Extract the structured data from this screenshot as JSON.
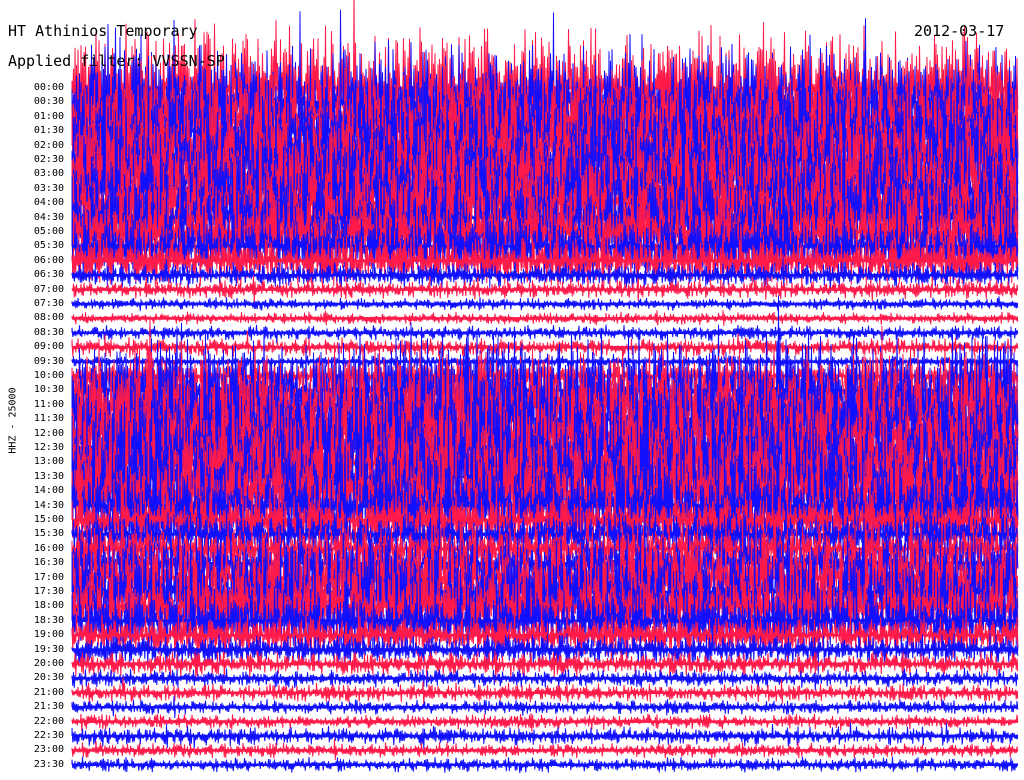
{
  "header": {
    "station": "HT Athinios Temporary",
    "date": "2012-03-17",
    "filter": "Applied filter: VVSSN-SP"
  },
  "axis_label": "HHZ - 25000",
  "chart_data": {
    "type": "helicorder",
    "title": "HT Athinios Temporary",
    "date": "2012-03-17",
    "channel_label": "HHZ - 25000",
    "row_interval_minutes": 30,
    "colors": {
      "odd": "#ff1a4a",
      "even": "#1010ff"
    },
    "rows": [
      {
        "time": "00:00",
        "amplitude": 1.0
      },
      {
        "time": "00:30",
        "amplitude": 1.0
      },
      {
        "time": "01:00",
        "amplitude": 1.0
      },
      {
        "time": "01:30",
        "amplitude": 1.0
      },
      {
        "time": "02:00",
        "amplitude": 1.0
      },
      {
        "time": "02:30",
        "amplitude": 1.0
      },
      {
        "time": "03:00",
        "amplitude": 1.0
      },
      {
        "time": "03:30",
        "amplitude": 1.0
      },
      {
        "time": "04:00",
        "amplitude": 1.0
      },
      {
        "time": "04:30",
        "amplitude": 0.9
      },
      {
        "time": "05:00",
        "amplitude": 0.8
      },
      {
        "time": "05:30",
        "amplitude": 0.6
      },
      {
        "time": "06:00",
        "amplitude": 0.45
      },
      {
        "time": "06:30",
        "amplitude": 0.2
      },
      {
        "time": "07:00",
        "amplitude": 0.15
      },
      {
        "time": "07:30",
        "amplitude": 0.1
      },
      {
        "time": "08:00",
        "amplitude": 0.1
      },
      {
        "time": "08:30",
        "amplitude": 0.12
      },
      {
        "time": "09:00",
        "amplitude": 0.15
      },
      {
        "time": "09:30",
        "amplitude": 0.1
      },
      {
        "time": "10:00",
        "amplitude": 0.3
      },
      {
        "time": "10:30",
        "amplitude": 1.0
      },
      {
        "time": "11:00",
        "amplitude": 1.0
      },
      {
        "time": "11:30",
        "amplitude": 1.0
      },
      {
        "time": "12:00",
        "amplitude": 1.0
      },
      {
        "time": "12:30",
        "amplitude": 1.0
      },
      {
        "time": "13:00",
        "amplitude": 1.0
      },
      {
        "time": "13:30",
        "amplitude": 1.0
      },
      {
        "time": "14:00",
        "amplitude": 1.0
      },
      {
        "time": "14:30",
        "amplitude": 0.9
      },
      {
        "time": "15:00",
        "amplitude": 0.5
      },
      {
        "time": "15:30",
        "amplitude": 0.4
      },
      {
        "time": "16:00",
        "amplitude": 0.4
      },
      {
        "time": "16:30",
        "amplitude": 0.5
      },
      {
        "time": "17:00",
        "amplitude": 0.9
      },
      {
        "time": "17:30",
        "amplitude": 0.9
      },
      {
        "time": "18:00",
        "amplitude": 0.8
      },
      {
        "time": "18:30",
        "amplitude": 0.6
      },
      {
        "time": "19:00",
        "amplitude": 0.35
      },
      {
        "time": "19:30",
        "amplitude": 0.25
      },
      {
        "time": "20:00",
        "amplitude": 0.2
      },
      {
        "time": "20:30",
        "amplitude": 0.15
      },
      {
        "time": "21:00",
        "amplitude": 0.15
      },
      {
        "time": "21:30",
        "amplitude": 0.12
      },
      {
        "time": "22:00",
        "amplitude": 0.12
      },
      {
        "time": "22:30",
        "amplitude": 0.15
      },
      {
        "time": "23:00",
        "amplitude": 0.12
      },
      {
        "time": "23:30",
        "amplitude": 0.12
      }
    ]
  }
}
